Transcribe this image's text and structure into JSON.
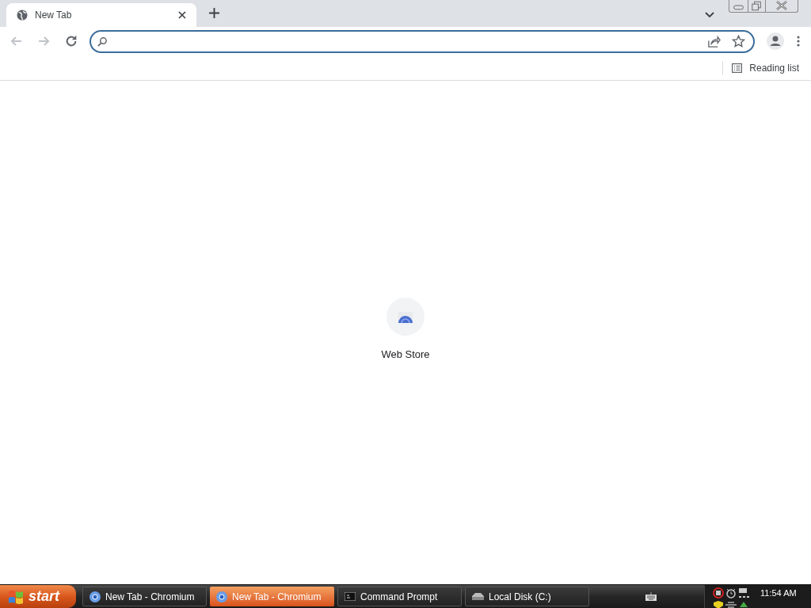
{
  "tabs": [
    {
      "title": "New Tab",
      "selected": true
    }
  ],
  "bookmarks_bar": {
    "reading_list": "Reading list"
  },
  "shortcuts": [
    {
      "label": "Web Store"
    }
  ],
  "taskbar": {
    "start": "start",
    "items": [
      {
        "label": "New Tab - Chromium",
        "kind": "chromium",
        "selected": false
      },
      {
        "label": "New Tab - Chromium",
        "kind": "chromium",
        "selected": true
      },
      {
        "label": "Command Prompt",
        "kind": "cmd",
        "selected": false
      },
      {
        "label": "Local Disk (C:)",
        "kind": "disk",
        "selected": false
      }
    ],
    "clock": "11:54 AM"
  }
}
